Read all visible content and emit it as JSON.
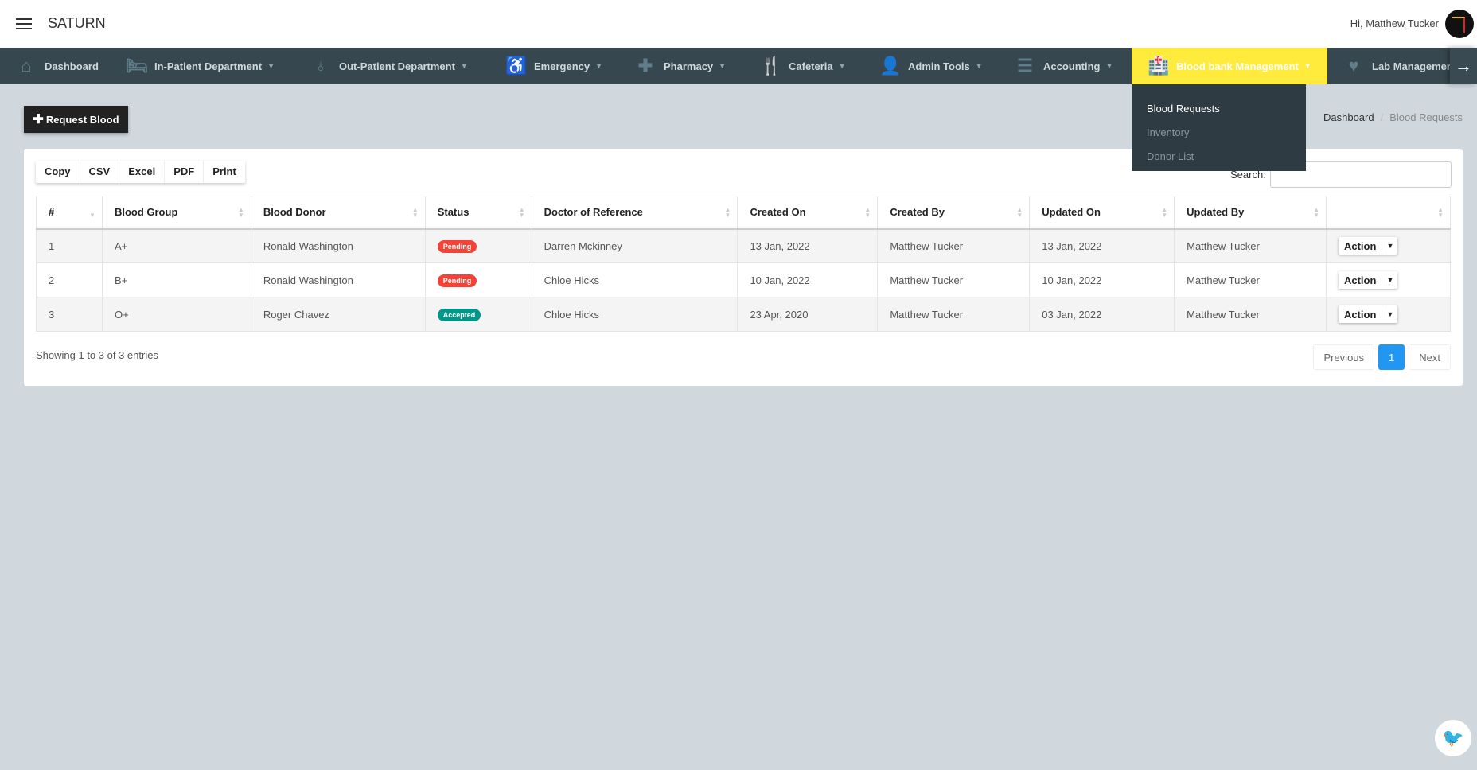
{
  "header": {
    "brand": "SATURN",
    "greeting": "Hi, Matthew Tucker"
  },
  "nav": [
    {
      "label": "Dashboard",
      "icon": "home-icon",
      "glyph": "⌂",
      "caret": false
    },
    {
      "label": "In-Patient Department",
      "icon": "bed-icon",
      "glyph": "🛏",
      "caret": true
    },
    {
      "label": "Out-Patient Department",
      "icon": "stethoscope-icon",
      "glyph": "♁",
      "caret": true
    },
    {
      "label": "Emergency",
      "icon": "wheelchair-icon",
      "glyph": "♿",
      "caret": true
    },
    {
      "label": "Pharmacy",
      "icon": "medkit-icon",
      "glyph": "✚",
      "caret": true
    },
    {
      "label": "Cafeteria",
      "icon": "cutlery-icon",
      "glyph": "🍴",
      "caret": true
    },
    {
      "label": "Admin Tools",
      "icon": "user-icon",
      "glyph": "👤",
      "caret": true
    },
    {
      "label": "Accounting",
      "icon": "list-ol-icon",
      "glyph": "☰",
      "caret": true
    },
    {
      "label": "Blood bank Management",
      "icon": "hospital-icon",
      "glyph": "🏥",
      "caret": true,
      "active": true
    },
    {
      "label": "Lab Managemen",
      "icon": "heartbeat-icon",
      "glyph": "♥",
      "caret": false
    }
  ],
  "active_color": "#ffeb3b",
  "dropdown": [
    "Blood Requests",
    "Inventory",
    "Donor List"
  ],
  "request_button": "Request Blood",
  "breadcrumb": [
    "Dashboard",
    "Blood Requests"
  ],
  "tools": [
    "Copy",
    "CSV",
    "Excel",
    "PDF",
    "Print"
  ],
  "search_label": "Search:",
  "columns": [
    "#",
    "Blood Group",
    "Blood Donor",
    "Status",
    "Doctor of Reference",
    "Created On",
    "Created By",
    "Updated On",
    "Updated By",
    ""
  ],
  "rows": [
    {
      "n": "1",
      "group": "A+",
      "donor": "Ronald Washington",
      "status": "Pending",
      "status_color": "#f44336",
      "doctor": "Darren Mckinney",
      "created_on": "13 Jan, 2022",
      "created_by": "Matthew Tucker",
      "updated_on": "13 Jan, 2022",
      "updated_by": "Matthew Tucker",
      "action": "Action"
    },
    {
      "n": "2",
      "group": "B+",
      "donor": "Ronald Washington",
      "status": "Pending",
      "status_color": "#f44336",
      "doctor": "Chloe Hicks",
      "created_on": "10 Jan, 2022",
      "created_by": "Matthew Tucker",
      "updated_on": "10 Jan, 2022",
      "updated_by": "Matthew Tucker",
      "action": "Action"
    },
    {
      "n": "3",
      "group": "O+",
      "donor": "Roger Chavez",
      "status": "Accepted",
      "status_color": "#009688",
      "doctor": "Chloe Hicks",
      "created_on": "23 Apr, 2020",
      "created_by": "Matthew Tucker",
      "updated_on": "03 Jan, 2022",
      "updated_by": "Matthew Tucker",
      "action": "Action"
    }
  ],
  "info": "Showing 1 to 3 of 3 entries",
  "pager": {
    "prev": "Previous",
    "current": "1",
    "next": "Next"
  }
}
